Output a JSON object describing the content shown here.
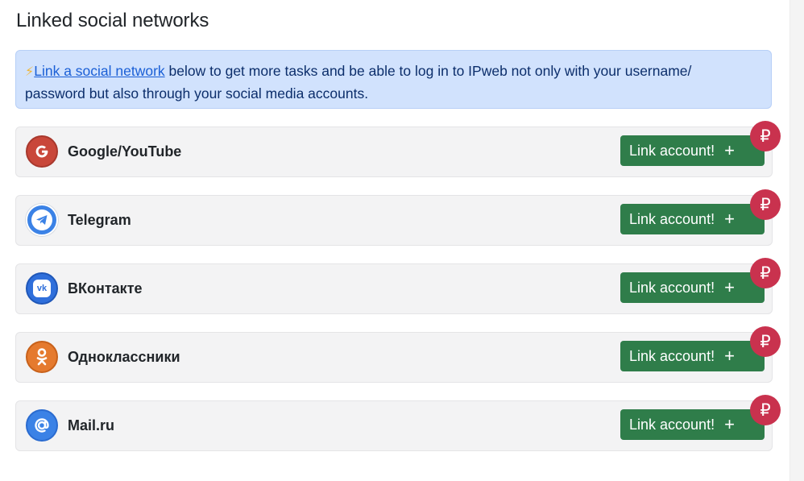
{
  "page": {
    "title": "Linked social networks"
  },
  "alert": {
    "icon": "lightning-icon",
    "link_text": "Link a social network",
    "text_line1": " below to get more tasks and be able to log in to IPweb not only with your username/",
    "text_line2": "password but also through your social media accounts."
  },
  "networks": [
    {
      "name": "Google/YouTube",
      "icon": "google-icon",
      "color": "#c9473a",
      "button": "Link account!",
      "plus": "+",
      "badge": "₽"
    },
    {
      "name": "Telegram",
      "icon": "telegram-icon",
      "color": "#3b82e6",
      "button": "Link account!",
      "plus": "+",
      "badge": "₽"
    },
    {
      "name": "ВКонтакте",
      "icon": "vk-icon",
      "color": "#2f6fdb",
      "button": "Link account!",
      "plus": "+",
      "badge": "₽"
    },
    {
      "name": "Одноклассники",
      "icon": "odnoklassniki-icon",
      "color": "#e57a2e",
      "button": "Link account!",
      "plus": "+",
      "badge": "₽"
    },
    {
      "name": "Mail.ru",
      "icon": "at-sign-icon",
      "color": "#3b82e6",
      "button": "Link account!",
      "plus": "+",
      "badge": "₽"
    }
  ],
  "colors": {
    "button": "#2f7d4a",
    "badge": "#c9324e",
    "alert_bg": "#d1e2fd"
  }
}
